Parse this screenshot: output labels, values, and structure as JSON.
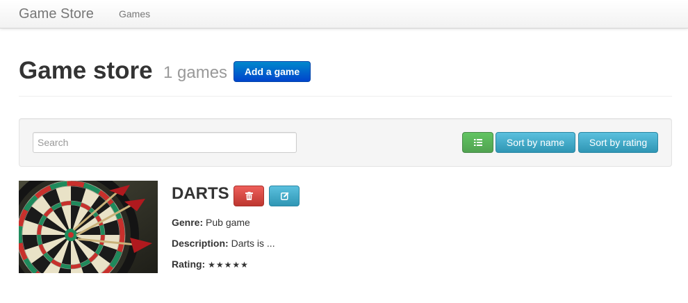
{
  "navbar": {
    "brand": "Game Store",
    "links": [
      {
        "label": "Games"
      }
    ]
  },
  "header": {
    "title": "Game store",
    "count": "1 games",
    "add_label": "Add a game"
  },
  "toolbar": {
    "search_placeholder": "Search",
    "search_value": "",
    "list_icon": "list-icon",
    "sort_name_label": "Sort by name",
    "sort_rating_label": "Sort by rating"
  },
  "games": [
    {
      "name": "DARTS",
      "image_icon": "dartboard-image",
      "genre_label": "Genre:",
      "genre": "Pub game",
      "description_label": "Description:",
      "description": "Darts is ...",
      "rating_label": "Rating:",
      "rating_stars": "★★★★★",
      "rating_value": 5,
      "rating_max": 5,
      "delete_icon": "trash-icon",
      "edit_icon": "edit-icon"
    }
  ],
  "colors": {
    "primary": "#0055cc",
    "success": "#51a351",
    "info": "#2f96b4",
    "danger": "#bd362f"
  }
}
